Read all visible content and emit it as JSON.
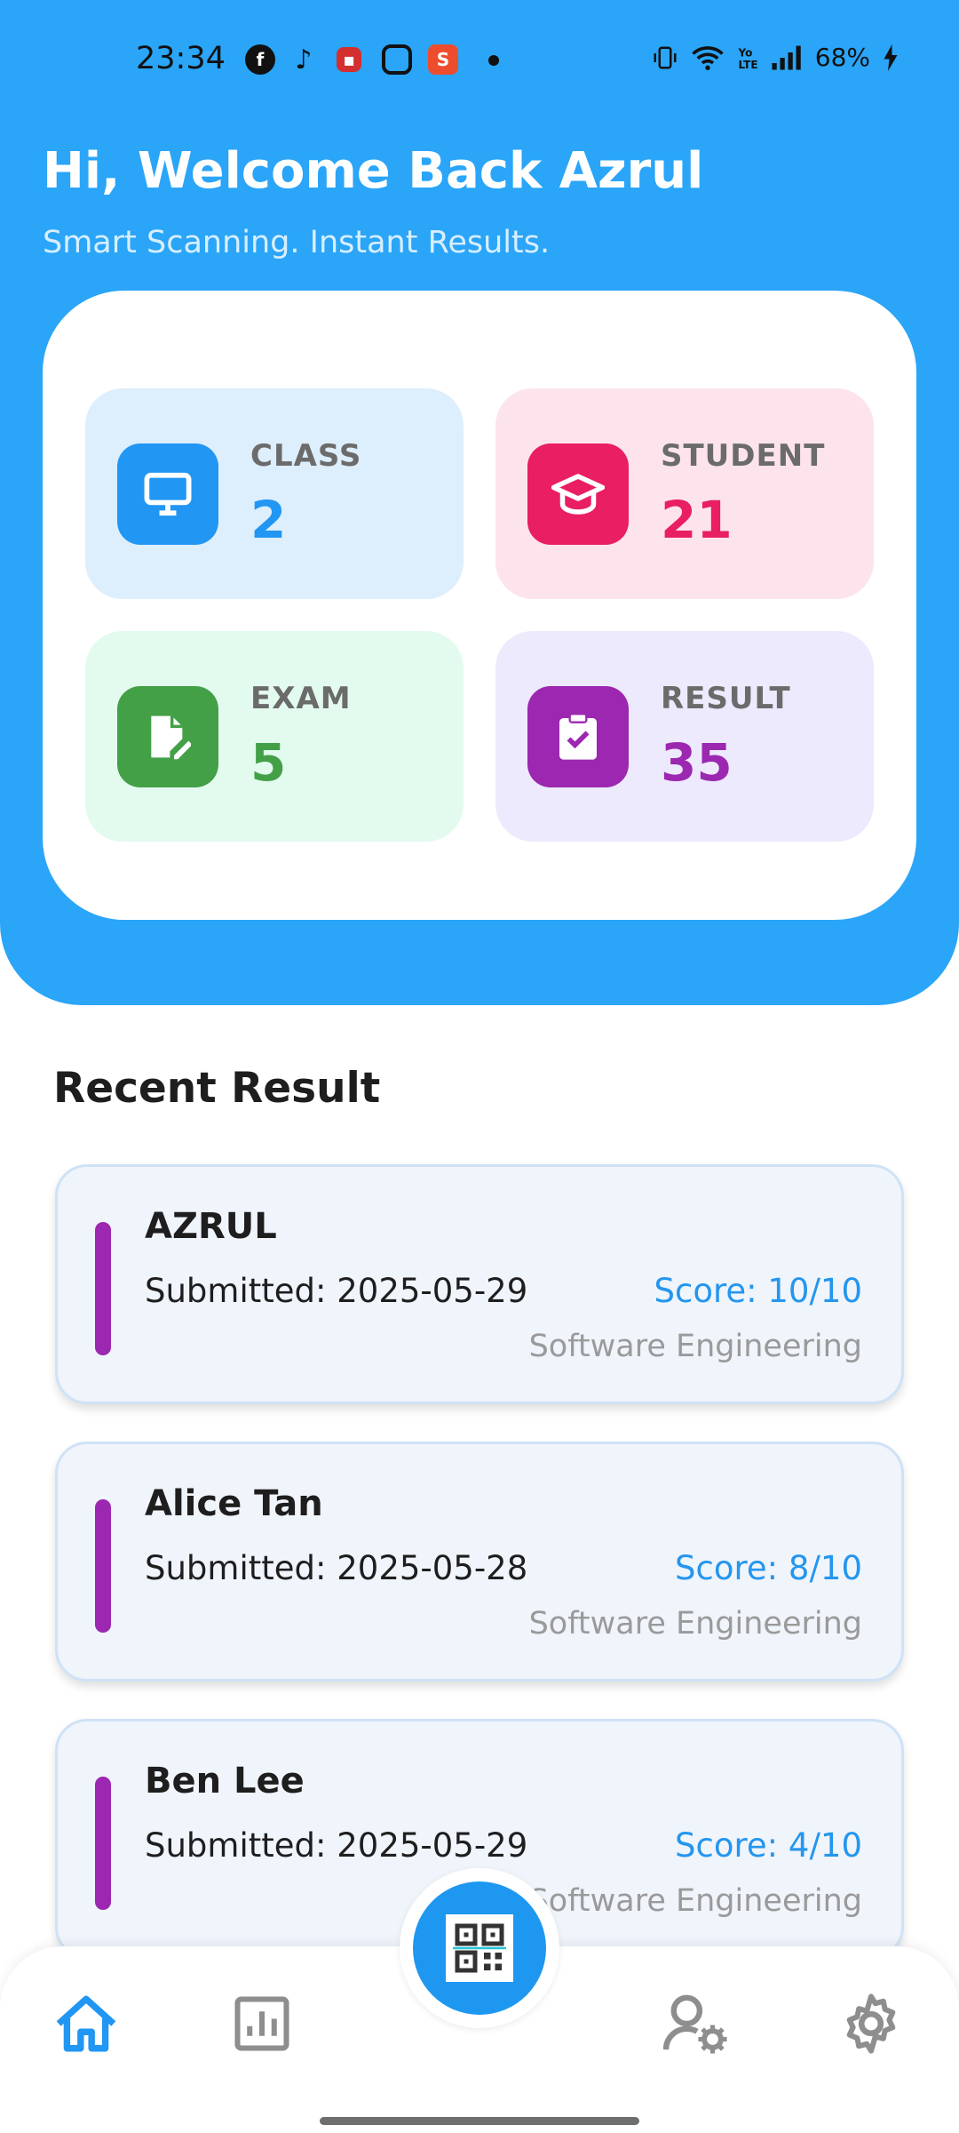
{
  "status_bar": {
    "time": "23:34",
    "battery": "68%"
  },
  "header": {
    "greeting": "Hi, Welcome Back Azrul",
    "tagline": "Smart Scanning. Instant Results."
  },
  "stats": [
    {
      "label": "CLASS",
      "value": "2",
      "icon": "monitor-icon",
      "bg": "#DDEEFD",
      "icon_bg": "#2196F3",
      "value_color": "#2196F3"
    },
    {
      "label": "STUDENT",
      "value": "21",
      "icon": "graduation-cap-icon",
      "bg": "#FDE4EC",
      "icon_bg": "#E91E63",
      "value_color": "#E91E63"
    },
    {
      "label": "EXAM",
      "value": "5",
      "icon": "edit-document-icon",
      "bg": "#E3FBEF",
      "icon_bg": "#43A047",
      "value_color": "#43A047"
    },
    {
      "label": "RESULT",
      "value": "35",
      "icon": "clipboard-check-icon",
      "bg": "#ECEAFC",
      "icon_bg": "#9C27B0",
      "value_color": "#9C27B0"
    }
  ],
  "recent": {
    "title": "Recent Result",
    "items": [
      {
        "name": "AZRUL",
        "submitted": "Submitted: 2025-05-29",
        "score": "Score: 10/10",
        "course": "Software Engineering"
      },
      {
        "name": "Alice Tan",
        "submitted": "Submitted: 2025-05-28",
        "score": "Score: 8/10",
        "course": "Software Engineering"
      },
      {
        "name": "Ben Lee",
        "submitted": "Submitted: 2025-05-29",
        "score": "Score: 4/10",
        "course": "Software Engineering"
      }
    ]
  },
  "nav": {
    "items": [
      "home-icon",
      "report-chart-icon",
      "qr-scan-icon",
      "user-settings-icon",
      "gear-icon"
    ],
    "active": "home-icon",
    "active_color": "#2196F3",
    "inactive_color": "#8E8E8E"
  }
}
